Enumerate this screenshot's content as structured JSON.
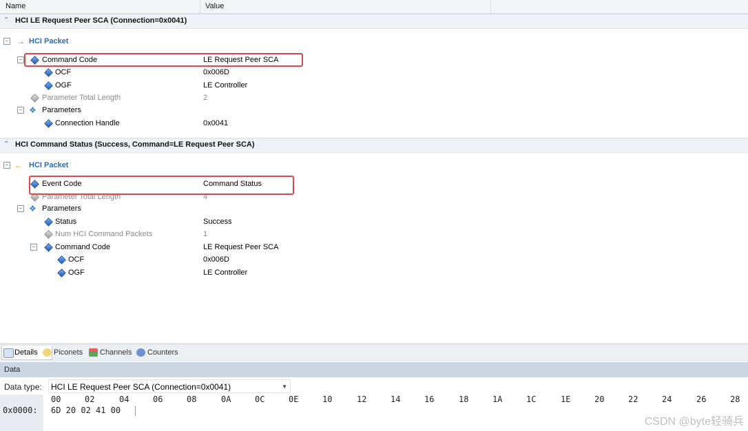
{
  "columns": {
    "name": "Name",
    "value": "Value"
  },
  "section1": {
    "title": "HCI LE Request Peer SCA (Connection=0x0041)",
    "packet_label": "HCI Packet",
    "rows": [
      {
        "name": "Command Code",
        "value": "LE Request Peer SCA"
      },
      {
        "name": "OCF",
        "value": "0x006D"
      },
      {
        "name": "OGF",
        "value": "LE Controller"
      },
      {
        "name": "Parameter Total Length",
        "value": "2"
      },
      {
        "name": "Parameters",
        "value": ""
      },
      {
        "name": "Connection Handle",
        "value": "0x0041"
      }
    ]
  },
  "section2": {
    "title": "HCI Command Status (Success, Command=LE Request Peer SCA)",
    "packet_label": "HCI Packet",
    "rows": [
      {
        "name": "Event Code",
        "value": "Command Status"
      },
      {
        "name": "Parameter Total Length",
        "value": "4"
      },
      {
        "name": "Parameters",
        "value": ""
      },
      {
        "name": "Status",
        "value": "Success"
      },
      {
        "name": "Num HCI Command Packets",
        "value": "1"
      },
      {
        "name": "Command Code",
        "value": "LE Request Peer SCA"
      },
      {
        "name": "OCF",
        "value": "0x006D"
      },
      {
        "name": "OGF",
        "value": "LE Controller"
      }
    ]
  },
  "tabs": [
    {
      "label": "Details"
    },
    {
      "label": "Piconets"
    },
    {
      "label": "Channels"
    },
    {
      "label": "Counters"
    }
  ],
  "data_panel": {
    "header": "Data",
    "type_label": "Data type:",
    "type_value": "HCI LE Request Peer SCA (Connection=0x0041)",
    "offsets": [
      "00",
      "02",
      "04",
      "06",
      "08",
      "0A",
      "0C",
      "0E",
      "10",
      "12",
      "14",
      "16",
      "18",
      "1A",
      "1C",
      "1E",
      "20",
      "22",
      "24",
      "26",
      "28"
    ],
    "address": "0x0000:",
    "bytes": "6D 20 02 41 00"
  },
  "watermark": "CSDN @byte轻骑兵"
}
